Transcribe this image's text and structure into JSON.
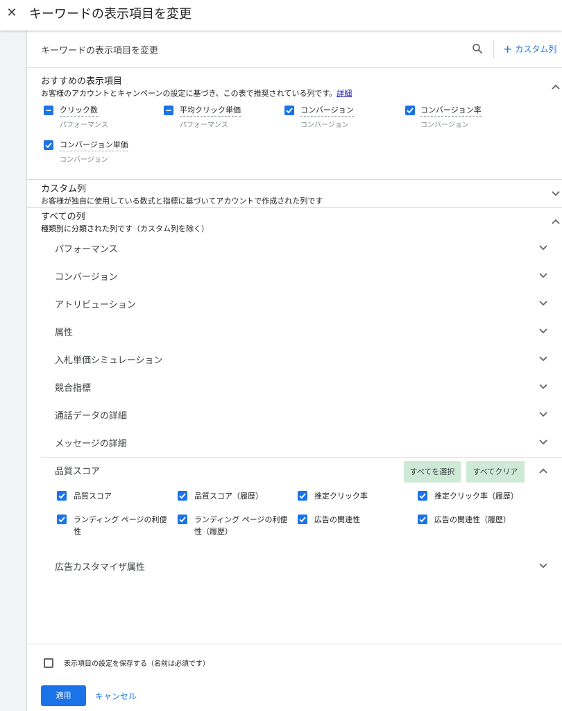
{
  "window": {
    "title": "キーワードの表示項目を変更"
  },
  "header": {
    "title": "キーワードの表示項目を変更",
    "custom_column_label": "カスタム列"
  },
  "recommended": {
    "title": "おすすめの表示項目",
    "description": "お客様のアカウントとキャンペーンの設定に基づき、この表で推奨されている列です。",
    "details_link": "詳細",
    "items": [
      {
        "label": "クリック数",
        "sub": "パフォーマンス",
        "state": "indeterminate"
      },
      {
        "label": "平均クリック単価",
        "sub": "パフォーマンス",
        "state": "indeterminate"
      },
      {
        "label": "コンバージョン",
        "sub": "コンバージョン",
        "state": "checked"
      },
      {
        "label": "コンバージョン率",
        "sub": "コンバージョン",
        "state": "checked"
      },
      {
        "label": "コンバージョン単価",
        "sub": "コンバージョン",
        "state": "checked"
      }
    ]
  },
  "custom": {
    "title": "カスタム列",
    "description": "お客様が独自に使用している数式と指標に基づいてアカウントで作成された列です"
  },
  "all": {
    "title": "すべての列",
    "description": "種類別に分類された列です（カスタム列を除く）",
    "categories": [
      "パフォーマンス",
      "コンバージョン",
      "アトリビューション",
      "属性",
      "入札単価シミュレーション",
      "競合指標",
      "通話データの詳細",
      "メッセージの詳細"
    ],
    "quality_score": {
      "title": "品質スコア",
      "select_all": "すべてを選択",
      "clear_all": "すべてクリア",
      "items": [
        {
          "label": "品質スコア",
          "checked": true
        },
        {
          "label": "品質スコア（履歴）",
          "checked": true
        },
        {
          "label": "推定クリック率",
          "checked": true
        },
        {
          "label": "推定クリック率（履歴）",
          "checked": true
        },
        {
          "label": "ランディング ページの利便性",
          "checked": true
        },
        {
          "label": "ランディング ページの利便性（履歴）",
          "checked": true
        },
        {
          "label": "広告の関連性",
          "checked": true
        },
        {
          "label": "広告の関連性（履歴）",
          "checked": true
        }
      ]
    },
    "last_category": "広告カスタマイザ属性"
  },
  "footer": {
    "save_label": "表示項目の設定を保存する（名前は必須です）",
    "save_checked": false,
    "apply": "適用",
    "cancel": "キャンセル"
  },
  "colors": {
    "accent": "#1a73e8",
    "chip_bg": "#ceead6",
    "divider": "#dadce0"
  }
}
